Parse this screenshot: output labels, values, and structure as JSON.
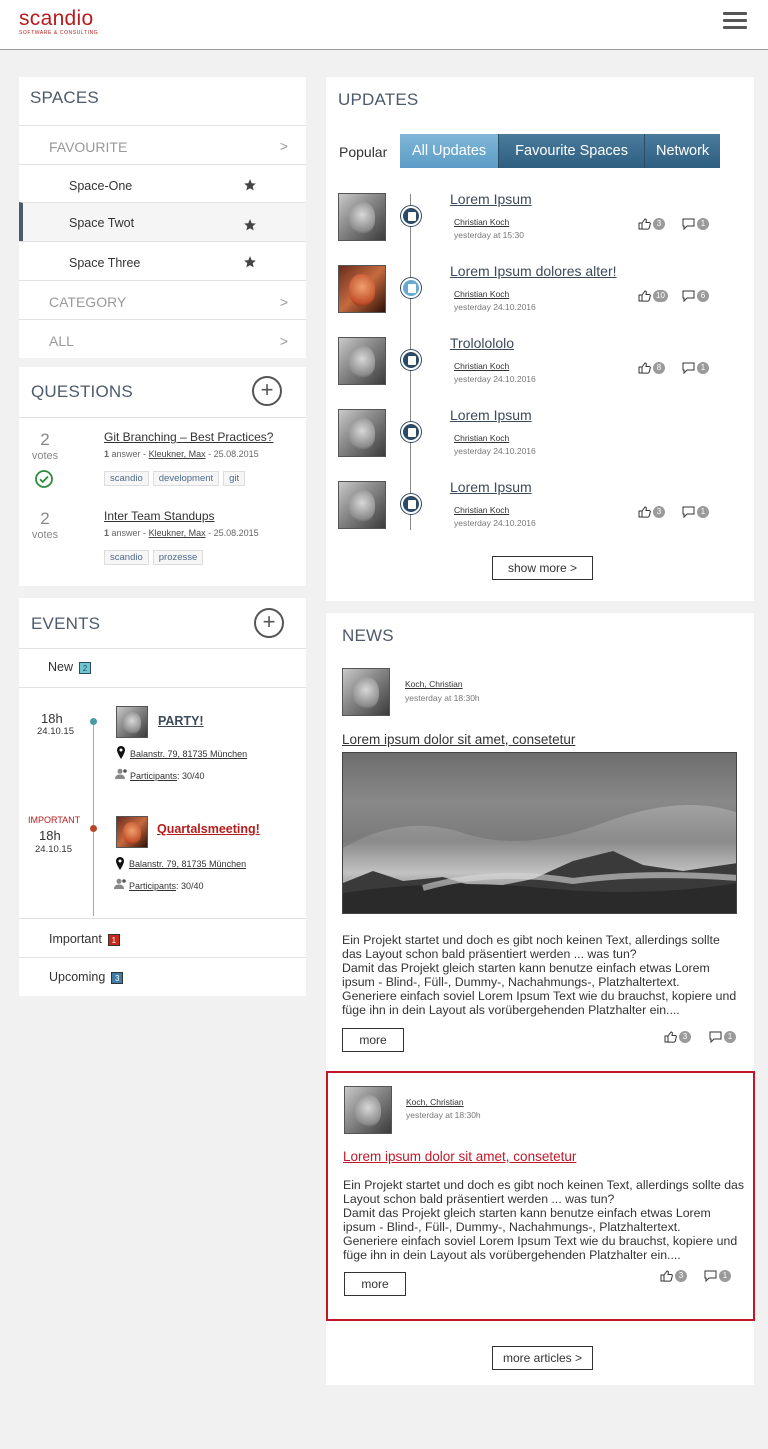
{
  "header": {
    "logo": "scandio",
    "logo_sub": "SOFTWARE & CONSULTING"
  },
  "spaces": {
    "title": "SPACES",
    "favourite": "FAVOURITE",
    "items": [
      {
        "label": "Space-One"
      },
      {
        "label": "Space Twot"
      },
      {
        "label": "Space Three"
      }
    ],
    "category": "CATEGORY",
    "all": "ALL",
    "chevron": ">"
  },
  "questions": {
    "title": "QUESTIONS",
    "items": [
      {
        "votes": "2",
        "votes_label": "votes",
        "title": "Git Branching – Best Practices?",
        "answers": "1",
        "answer_label": "answer -",
        "author": "Kleukner, Max",
        "date": "- 25.08.2015",
        "tags": [
          "scandio",
          "development",
          "git"
        ],
        "accepted": true
      },
      {
        "votes": "2",
        "votes_label": "votes",
        "title": "Inter Team Standups",
        "answers": "1",
        "answer_label": "answer -",
        "author": "Kleukner, Max",
        "date": "- 25.08.2015",
        "tags": [
          "scandio",
          "prozesse"
        ],
        "accepted": false
      }
    ]
  },
  "events": {
    "title": "EVENTS",
    "new_label": "New",
    "new_count": "2",
    "items": [
      {
        "time": "18h",
        "date": "24.10.15",
        "important": "",
        "title": "PARTY!",
        "address": "Balanstr. 79, 81735 München",
        "participants_label": "Participants",
        "participants": ": 30/40"
      },
      {
        "time": "18h",
        "date": "24.10.15",
        "important": "IMPORTANT",
        "title": "Quartalsmeeting!",
        "address": "Balanstr. 79, 81735 München",
        "participants_label": "Participants",
        "participants": ": 30/40"
      }
    ],
    "important_label": "Important",
    "important_count": "1",
    "upcoming_label": "Upcoming",
    "upcoming_count": "3"
  },
  "updates": {
    "title": "UPDATES",
    "popular": "Popular",
    "tabs": [
      "All Updates",
      "Favourite Spaces",
      "Network"
    ],
    "items": [
      {
        "title": "Lorem Ipsum",
        "author": "Christian Koch",
        "time": "yesterday at 15:30",
        "likes": "3",
        "comments": "1"
      },
      {
        "title": "Lorem Ipsum dolores alter!",
        "author": "Christian Koch",
        "time": "yesterday 24.10.2016",
        "likes": "10",
        "comments": "6"
      },
      {
        "title": "Trololololo",
        "author": "Christian Koch",
        "time": "yesterday 24.10.2016",
        "likes": "8",
        "comments": "1"
      },
      {
        "title": "Lorem Ipsum",
        "author": "Christian Koch",
        "time": "yesterday 24.10.2016",
        "likes": "",
        "comments": ""
      },
      {
        "title": "Lorem Ipsum",
        "author": "Christian Koch",
        "time": "yesterday 24.10.2016",
        "likes": "3",
        "comments": "1"
      }
    ],
    "show_more": "show more >"
  },
  "news": {
    "title": "NEWS",
    "items": [
      {
        "author": "Koch, Christian",
        "time": "yesterday at 18:30h",
        "title": "Lorem ipsum dolor sit amet,  consetetur",
        "body": "Ein Projekt startet und doch es gibt noch keinen Text, allerdings sollte das Layout schon bald präsentiert werden ... was tun?\nDamit das Projekt gleich starten kann benutze einfach etwas Lorem ipsum - Blind-, Füll-, Dummy-, Nachahmungs-, Platzhaltertext.\nGeneriere einfach soviel Lorem Ipsum Text wie du brauchst, kopiere und füge ihn in dein Layout als vorübergehenden Platzhalter ein....",
        "more": "more",
        "likes": "3",
        "comments": "1"
      },
      {
        "author": "Koch, Christian",
        "time": "yesterday at 18:30h",
        "title": "Lorem ipsum dolor sit amet,  consetetur",
        "body": "Ein Projekt startet und doch es gibt noch keinen Text, allerdings sollte das Layout schon bald präsentiert werden ... was tun?\nDamit das Projekt gleich starten kann benutze einfach etwas Lorem ipsum - Blind-, Füll-, Dummy-, Nachahmungs-, Platzhaltertext.\nGeneriere einfach soviel Lorem Ipsum Text wie du brauchst, kopiere und füge ihn in dein Layout als vorübergehenden Platzhalter ein....",
        "more": "more",
        "likes": "3",
        "comments": "1"
      }
    ],
    "more_articles": "more articles >"
  },
  "colors": {
    "brand": "#b71c1c",
    "accent": "#2f5f80",
    "accent_light": "#6aa9cf",
    "highlight_border": "#c0182a"
  }
}
